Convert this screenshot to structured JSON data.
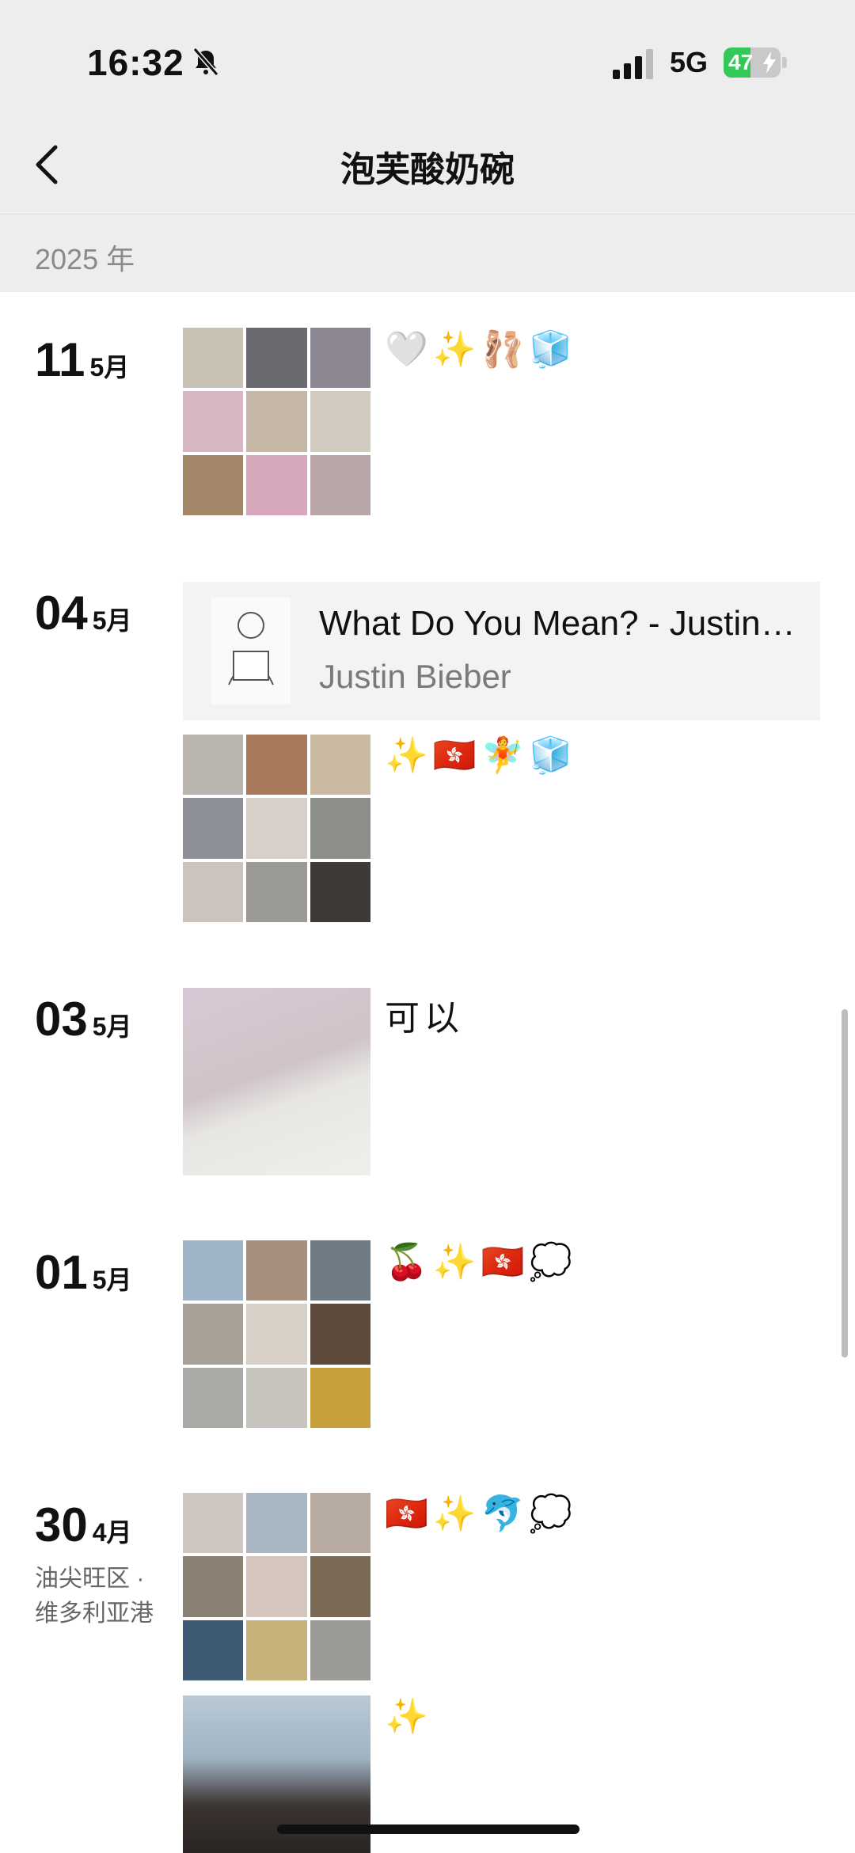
{
  "status_bar": {
    "time": "16:32",
    "network": "5G",
    "battery": "47",
    "battery_level": 0.47
  },
  "nav": {
    "title": "泡芙酸奶碗"
  },
  "year_header": "2025 年",
  "entries": [
    {
      "day": "11",
      "month": "5月",
      "caption": "🤍✨🩰🧊"
    },
    {
      "day": "04",
      "month": "5月",
      "music": {
        "song": "What Do You Mean? - Justin Bieber",
        "artist": "Justin Bieber"
      },
      "caption": "✨🇭🇰🧚🧊"
    },
    {
      "day": "03",
      "month": "5月",
      "caption": "可以"
    },
    {
      "day": "01",
      "month": "5月",
      "caption": "🍒✨🇭🇰💭"
    },
    {
      "day": "30",
      "month": "4月",
      "location_line1": "油尖旺区 ·",
      "location_line2": "维多利亚港",
      "caption": "🇭🇰✨🐬💭",
      "caption2": "✨"
    }
  ]
}
